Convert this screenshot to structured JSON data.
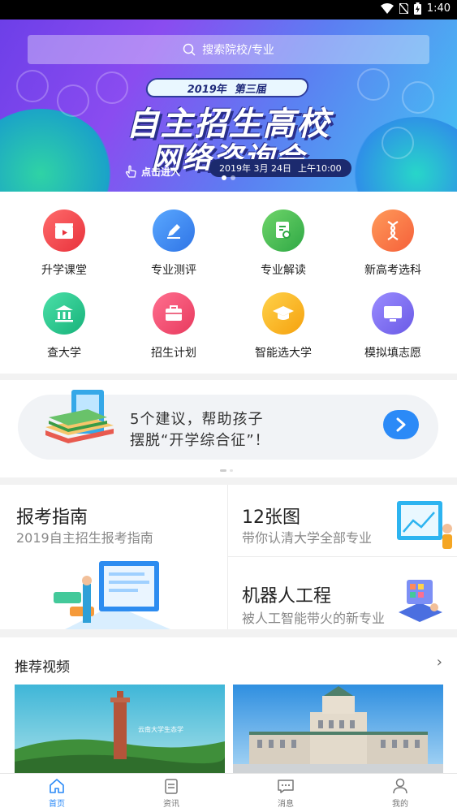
{
  "status_bar": {
    "time": "1:40"
  },
  "search": {
    "placeholder": "搜索院校/专业"
  },
  "banner": {
    "pill_year": "2019年",
    "pill_session": "第三届",
    "title_line1": "自主招生高校",
    "title_line2": "网络咨询会",
    "enter_label": "点击进入",
    "date_text": "2019年 3月 24日",
    "time_text": "上午10:00"
  },
  "grid": {
    "items": [
      {
        "label": "升学课堂",
        "icon": "video-clapper-icon",
        "color": "#f0474f"
      },
      {
        "label": "专业测评",
        "icon": "pencil-icon",
        "color": "#3d8bf0"
      },
      {
        "label": "专业解读",
        "icon": "document-search-icon",
        "color": "#3fb852"
      },
      {
        "label": "新高考选科",
        "icon": "dna-icon",
        "color": "#ff7747"
      },
      {
        "label": "查大学",
        "icon": "university-building-icon",
        "color": "#22c487"
      },
      {
        "label": "招生计划",
        "icon": "briefcase-icon",
        "color": "#f0456a"
      },
      {
        "label": "智能选大学",
        "icon": "graduation-cap-icon",
        "color": "#f5b418"
      },
      {
        "label": "模拟填志愿",
        "icon": "monitor-icon",
        "color": "#7a6df0"
      }
    ]
  },
  "promo": {
    "line1": "5个建议，帮助孩子",
    "line2": "摆脱“开学综合征”！"
  },
  "guide": {
    "left_title": "报考指南",
    "left_sub": "2019自主招生报考指南",
    "right_top_title": "12张图",
    "right_top_sub": "带你认清大学全部专业",
    "right_bottom_title": "机器人工程",
    "right_bottom_sub": "被人工智能带火的新专业"
  },
  "videos": {
    "heading": "推荐视频",
    "thumb1_caption": "云南大学生态学"
  },
  "tabs": [
    {
      "label": "首页",
      "icon": "home-icon"
    },
    {
      "label": "资讯",
      "icon": "news-icon"
    },
    {
      "label": "消息",
      "icon": "message-icon"
    },
    {
      "label": "我的",
      "icon": "user-icon"
    }
  ],
  "colors": {
    "accent": "#2b8af7",
    "text_secondary": "#888888"
  }
}
